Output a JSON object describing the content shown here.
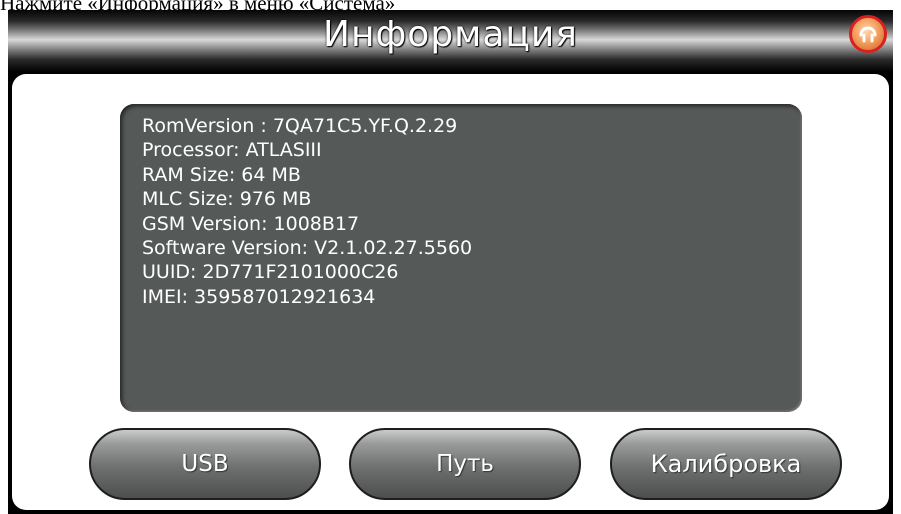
{
  "caption": "Нажмите «Информация» в меню «Система»",
  "header": {
    "title": "Информация",
    "home_icon": "home-icon"
  },
  "info": {
    "lines": [
      "RomVersion : 7QA71C5.YF.Q.2.29",
      "Processor: ATLASIII",
      "RAM Size: 64 MB",
      "MLC Size: 976 MB",
      "GSM Version: 1008B17",
      "Software Version: V2.1.02.27.5560",
      "UUID: 2D771F2101000C26",
      "IMEI: 359587012921634"
    ]
  },
  "buttons": {
    "usb": "USB",
    "path": "Путь",
    "calibration": "Калибровка"
  },
  "colors": {
    "info_background": "#555957",
    "home_ring": "#d92020",
    "home_fill": "#f4a060"
  }
}
